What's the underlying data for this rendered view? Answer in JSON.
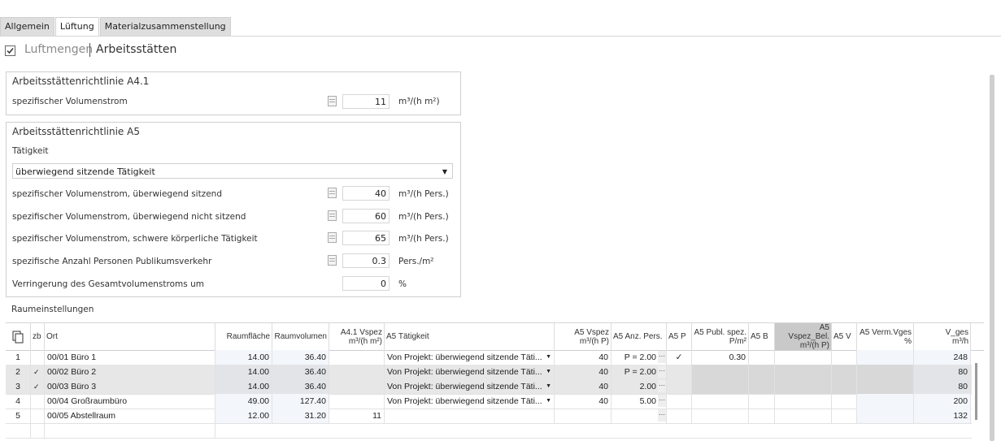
{
  "tabs": [
    "Allgemein",
    "Lüftung",
    "Materialzusammenstellung"
  ],
  "header": {
    "light": "Luftmengen",
    "dark": "Arbeitsstätten",
    "checked": true
  },
  "a41": {
    "title": "Arbeitsstättenrichtlinie A4.1",
    "label": "spezifischer Volumenstrom",
    "value": "11",
    "unit": "m³/(h m²)"
  },
  "a5": {
    "title": "Arbeitsstättenrichtlinie A5",
    "activity_label": "Tätigkeit",
    "activity_value": "überwiegend sitzende Tätigkeit",
    "rows": [
      {
        "label": "spezifischer Volumenstrom, überwiegend sitzend",
        "value": "40",
        "unit": "m³/(h Pers.)"
      },
      {
        "label": "spezifischer Volumenstrom, überwiegend nicht sitzend",
        "value": "60",
        "unit": "m³/(h Pers.)"
      },
      {
        "label": "spezifischer Volumenstrom, schwere körperliche Tätigkeit",
        "value": "65",
        "unit": "m³/(h Pers.)"
      },
      {
        "label": "spezifische Anzahl Personen Publikumsverkehr",
        "value": "0.3",
        "unit": "Pers./m²"
      },
      {
        "label": "Verringerung des Gesamtvolumenstroms um",
        "value": "0",
        "unit": "%"
      }
    ]
  },
  "rooms_label": "Raumeinstellungen",
  "grid": {
    "headers": {
      "zb": "zb",
      "ort": "Ort",
      "flaeche": "Raumfläche",
      "volumen": "Raumvolumen",
      "a41_1": "A4.1 Vspez",
      "a41_2": "m³/(h m²)",
      "taet": "A5 Tätigkeit",
      "a5v_1": "A5 Vspez",
      "a5v_2": "m³/(h P)",
      "anz": "A5 Anz. Pers.",
      "a5p": "A5 P",
      "publ_1": "A5 Publ. spez.",
      "publ_2": "P/m²",
      "a5b": "A5 B",
      "bel_1": "A5 Vspez_Bel.",
      "bel_2": "m³/(h P)",
      "a5v": "A5 V",
      "verm_1": "A5 Verm.Vges",
      "verm_2": "%",
      "vges_1": "V_ges",
      "vges_2": "m³/h"
    },
    "rows": [
      {
        "nr": "1",
        "zb": "",
        "ort": "00/01 Büro 1",
        "flaeche": "14.00",
        "volumen": "36.40",
        "a41": "",
        "taet": "Von Projekt: überwiegend sitzende Täti...",
        "a5v": "40",
        "anz": "P = 2.00",
        "a5p": "✓",
        "publ": "0.30",
        "vges": "248",
        "sel": false
      },
      {
        "nr": "2",
        "zb": "✓",
        "ort": "00/02 Büro 2",
        "flaeche": "14.00",
        "volumen": "36.40",
        "a41": "",
        "taet": "Von Projekt: überwiegend sitzende Täti...",
        "a5v": "40",
        "anz": "P = 2.00",
        "a5p": "",
        "publ": "",
        "vges": "80",
        "sel": true
      },
      {
        "nr": "3",
        "zb": "✓",
        "ort": "00/03 Büro 3",
        "flaeche": "14.00",
        "volumen": "36.40",
        "a41": "",
        "taet": "Von Projekt: überwiegend sitzende Täti...",
        "a5v": "40",
        "anz": "2.00",
        "a5p": "",
        "publ": "",
        "vges": "80",
        "sel": true
      },
      {
        "nr": "4",
        "zb": "",
        "ort": "00/04 Großraumbüro",
        "flaeche": "49.00",
        "volumen": "127.40",
        "a41": "",
        "taet": "Von Projekt: überwiegend sitzende Täti...",
        "a5v": "40",
        "anz": "5.00",
        "a5p": "",
        "publ": "",
        "vges": "200",
        "sel": false
      },
      {
        "nr": "5",
        "zb": "",
        "ort": "00/05 Abstellraum",
        "flaeche": "12.00",
        "volumen": "31.20",
        "a41": "11",
        "taet": "",
        "a5v": "",
        "anz": "",
        "a5p": "",
        "publ": "",
        "vges": "132",
        "sel": false
      }
    ]
  }
}
